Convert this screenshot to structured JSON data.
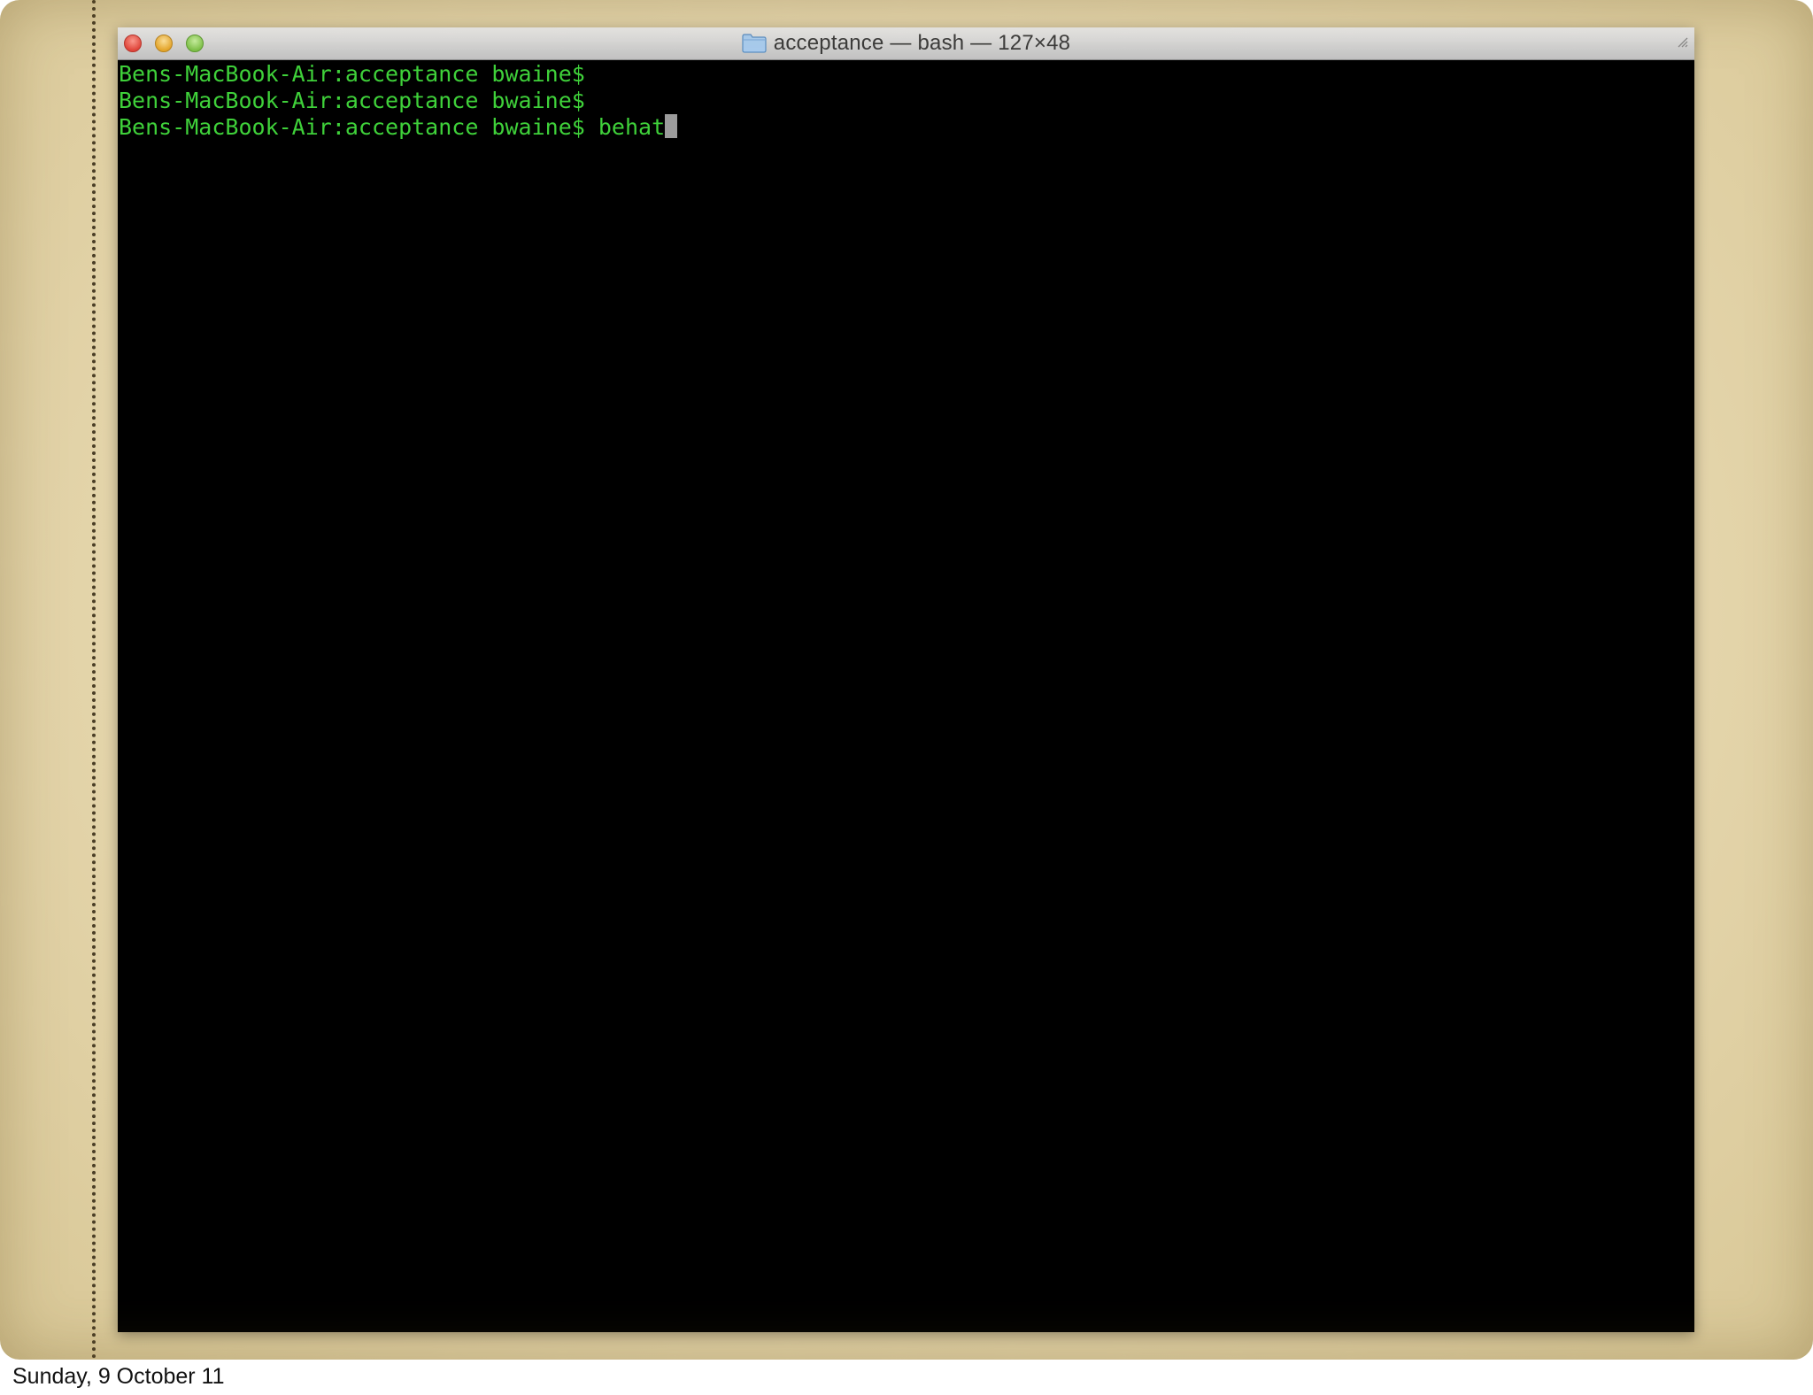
{
  "window": {
    "title": "acceptance — bash — 127×48"
  },
  "terminal": {
    "lines": [
      {
        "prompt": "Bens-MacBook-Air:acceptance bwaine$",
        "command": ""
      },
      {
        "prompt": "Bens-MacBook-Air:acceptance bwaine$",
        "command": ""
      },
      {
        "prompt": "Bens-MacBook-Air:acceptance bwaine$",
        "command": "behat"
      }
    ]
  },
  "footer": {
    "date": "Sunday, 9 October 11"
  },
  "colors": {
    "terminal_text": "#3fd13a",
    "terminal_background": "#000000",
    "cursor": "#9c9c9c"
  },
  "icons": [
    "close-button",
    "minimize-button",
    "zoom-button",
    "folder-icon",
    "resize-icon"
  ]
}
